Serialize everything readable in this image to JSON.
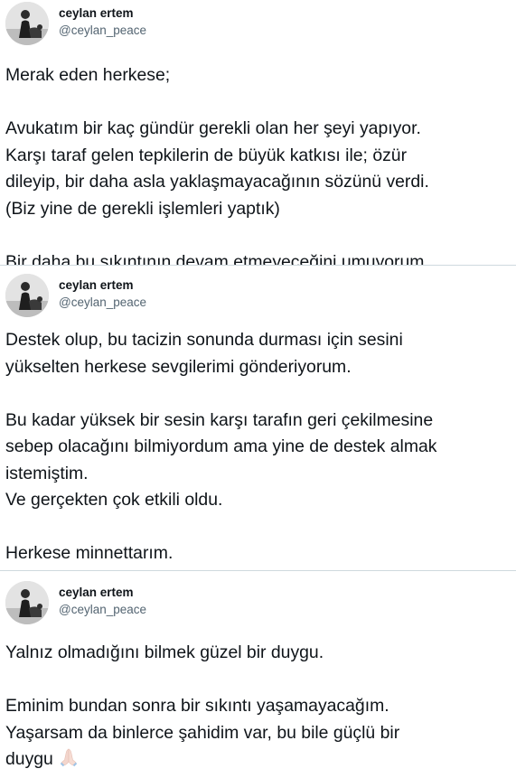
{
  "tweets": [
    {
      "author": {
        "name": "ceylan ertem",
        "handle": "@ceylan_peace"
      },
      "paragraphs": [
        [
          "Merak eden herkese;"
        ],
        [
          "Avukatım bir kaç gündür gerekli olan her şeyi yapıyor.",
          "Karşı taraf gelen tepkilerin de büyük katkısı ile; özür",
          "dileyip, bir daha asla yaklaşmayacağının sözünü verdi.",
          "(Biz yine de gerekli işlemleri yaptık)"
        ],
        [
          "Bir daha bu sıkıntının devam etmeyeceğini umuyorum."
        ]
      ]
    },
    {
      "author": {
        "name": "ceylan ertem",
        "handle": "@ceylan_peace"
      },
      "paragraphs": [
        [
          "Destek olup, bu tacizin sonunda durması için sesini",
          "yükselten herkese sevgilerimi gönderiyorum."
        ],
        [
          "Bu kadar yüksek bir sesin karşı tarafın geri çekilmesine",
          "sebep olacağını bilmiyordum ama yine de destek almak",
          "istemiştim.",
          "Ve gerçekten çok etkili oldu."
        ],
        [
          "Herkese minnettarım."
        ]
      ]
    },
    {
      "author": {
        "name": "ceylan ertem",
        "handle": "@ceylan_peace"
      },
      "paragraphs": [
        [
          "Yalnız olmadığını bilmek güzel bir duygu."
        ],
        [
          "Eminim bundan sonra bir sıkıntı yaşamayacağım.",
          "Yaşarsam da binlerce şahidim var, bu bile güçlü bir",
          "duygu"
        ]
      ],
      "trailing_emoji": "folded-hands-emoji"
    }
  ]
}
